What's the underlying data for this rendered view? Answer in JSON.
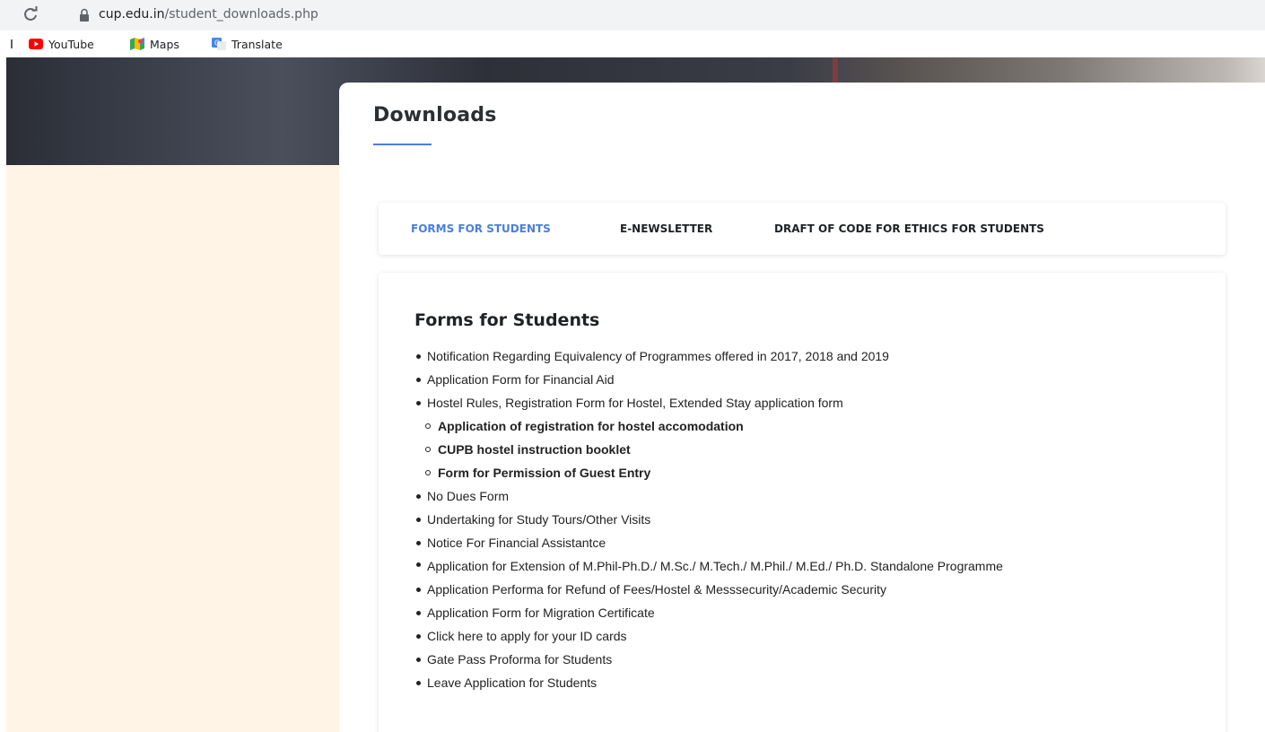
{
  "browser": {
    "url_host": "cup.edu.in",
    "url_path": "/student_downloads.php",
    "bookmarks": [
      {
        "label": "YouTube",
        "icon": "youtube-icon"
      },
      {
        "label": "Maps",
        "icon": "maps-icon"
      },
      {
        "label": "Translate",
        "icon": "translate-icon"
      }
    ]
  },
  "colors": {
    "accent": "#4a7ee0",
    "sidebar_bg": "#fff4e6"
  },
  "page": {
    "title": "Downloads",
    "tabs": [
      {
        "label": "FORMS FOR STUDENTS",
        "active": true
      },
      {
        "label": "E-NEWSLETTER",
        "active": false
      },
      {
        "label": "DRAFT OF CODE FOR ETHICS FOR STUDENTS",
        "active": false
      }
    ],
    "section_title": "Forms for Students",
    "items": [
      "Notification Regarding Equivalency of Programmes offered in 2017, 2018 and 2019",
      "Application Form for Financial Aid",
      "Hostel Rules, Registration Form for Hostel, Extended Stay application form",
      "Application of registration for hostel accomodation",
      "CUPB hostel instruction booklet",
      "Form for Permission of Guest Entry",
      "No Dues Form",
      "Undertaking for Study Tours/Other Visits",
      "Notice For Financial Assistantce",
      "Application for Extension of M.Phil-Ph.D./ M.Sc./ M.Tech./ M.Phil./ M.Ed./ Ph.D. Standalone Programme",
      "Application Performa for Refund of Fees/Hostel & Messsecurity/Academic Security",
      "Application Form for Migration Certificate",
      "Click here to apply for your ID cards",
      "Gate Pass Proforma for Students",
      "Leave Application for Students"
    ]
  }
}
